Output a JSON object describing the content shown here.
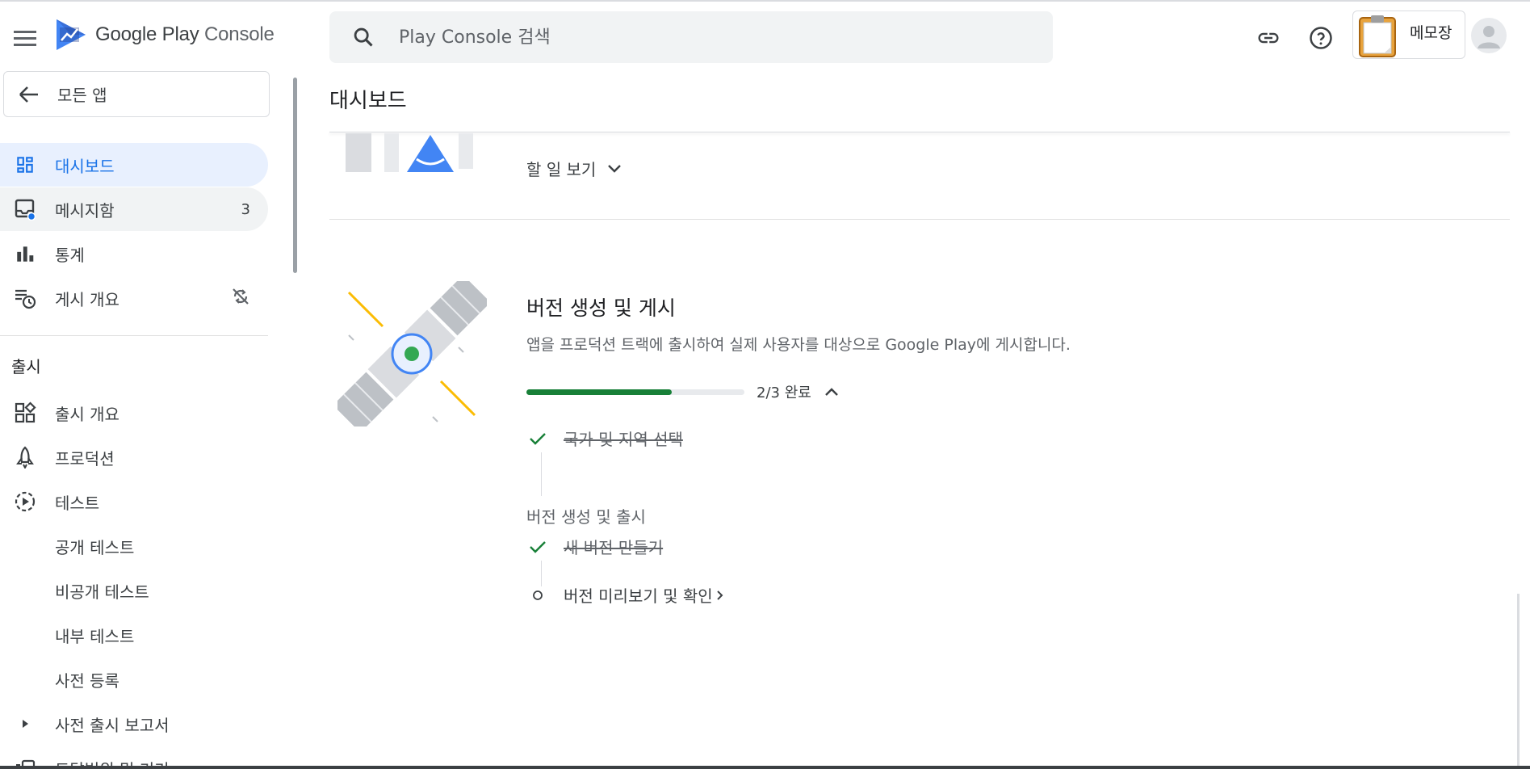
{
  "header": {
    "logo_text_a": "Google Play",
    "logo_text_b": "Console",
    "search_placeholder": "Play Console 검색",
    "memo_label": "메모장"
  },
  "sidebar": {
    "back_label": "모든 앱",
    "items": [
      {
        "label": "대시보드",
        "icon": "dashboard-icon",
        "active": true
      },
      {
        "label": "메시지함",
        "icon": "inbox-icon",
        "count": "3"
      },
      {
        "label": "통계",
        "icon": "bar-chart-icon"
      },
      {
        "label": "게시 개요",
        "icon": "publishing-overview-icon"
      }
    ],
    "section_title": "출시",
    "release_items": [
      {
        "label": "출시 개요",
        "icon": "release-overview-icon"
      },
      {
        "label": "프로덕션",
        "icon": "production-icon"
      },
      {
        "label": "테스트",
        "icon": "testing-icon"
      },
      {
        "label": "공개 테스트"
      },
      {
        "label": "비공개 테스트"
      },
      {
        "label": "내부 테스트"
      },
      {
        "label": "사전 등록"
      },
      {
        "label": "사전 출시 보고서",
        "icon": "expand-arrow-icon"
      },
      {
        "label": "도달범위 및 기기"
      }
    ]
  },
  "main": {
    "page_title": "대시보드",
    "todo_link": "할 일 보기",
    "card": {
      "title": "버전 생성 및 게시",
      "description": "앱을 프로덕션 트랙에 출시하여 실제 사용자를 대상으로 Google Play에 게시합니다.",
      "progress": 0.667,
      "progress_text": "2/3 완료",
      "task1": "국가 및 지역 선택",
      "group_label": "버전 생성 및 출시",
      "task2": "새 버전 만들기",
      "task3": "버전 미리보기 및 확인"
    }
  },
  "colors": {
    "accent": "#1a73e8",
    "active_bg": "#e8f0fe",
    "progress_green": "#188038",
    "check_green": "#188038"
  }
}
